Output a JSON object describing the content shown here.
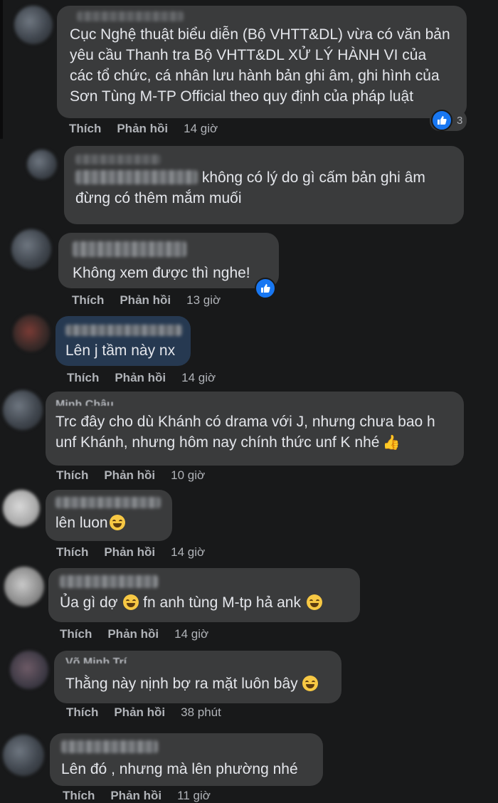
{
  "comments": [
    {
      "text": "Cục Nghệ thuật biểu diễn (Bộ VHTT&DL) vừa có văn bản yêu cầu Thanh tra Bộ VHTT&DL XỬ LÝ HÀNH VI của các tổ chức, cá nhân lưu hành bản ghi âm, ghi hình của Sơn Tùng M-TP Official theo quy định của pháp luật",
      "like": "Thích",
      "reply": "Phản hồi",
      "time": "14 giờ",
      "reaction_count": "3"
    },
    {
      "text": "không có lý do gì cấm bản ghi âm đừng có thêm mắm muối"
    },
    {
      "text": "Không xem được thì nghe!",
      "like": "Thích",
      "reply": "Phản hồi",
      "time": "13 giờ"
    },
    {
      "text": "Lên j tầm này nx",
      "like": "Thích",
      "reply": "Phản hồi",
      "time": "14 giờ"
    },
    {
      "name_partial": "Minh Châu",
      "text": "Trc đây cho dù Khánh có drama với J, nhưng chưa bao h unf Khánh, nhưng hôm nay chính thức unf K nhé",
      "like": "Thích",
      "reply": "Phản hồi",
      "time": "10 giờ"
    },
    {
      "text": "lên luon",
      "like": "Thích",
      "reply": "Phản hồi",
      "time": "14 giờ"
    },
    {
      "text_a": "Ủa gì dợ",
      "text_b": "fn anh tùng M-tp hả ank",
      "like": "Thích",
      "reply": "Phản hồi",
      "time": "14 giờ"
    },
    {
      "name_partial": "Võ Minh Trí",
      "text": "Thằng này nịnh bợ ra mặt luôn bây",
      "like": "Thích",
      "reply": "Phản hồi",
      "time": "38 phút"
    },
    {
      "text": "Lên đó , nhưng mà lên phường nhé",
      "like": "Thích",
      "reply": "Phản hồi",
      "time": "11 giờ"
    }
  ],
  "colors": {
    "background": "#18191a",
    "bubble": "#3a3b3c",
    "highlight_bubble": "#263951",
    "like_blue": "#1877f2"
  },
  "icons": [
    "like-reaction-icon",
    "winking-face-icon",
    "laughing-face-icon",
    "grinning-squint-face-icon",
    "thumbs-up-emoji-icon"
  ]
}
